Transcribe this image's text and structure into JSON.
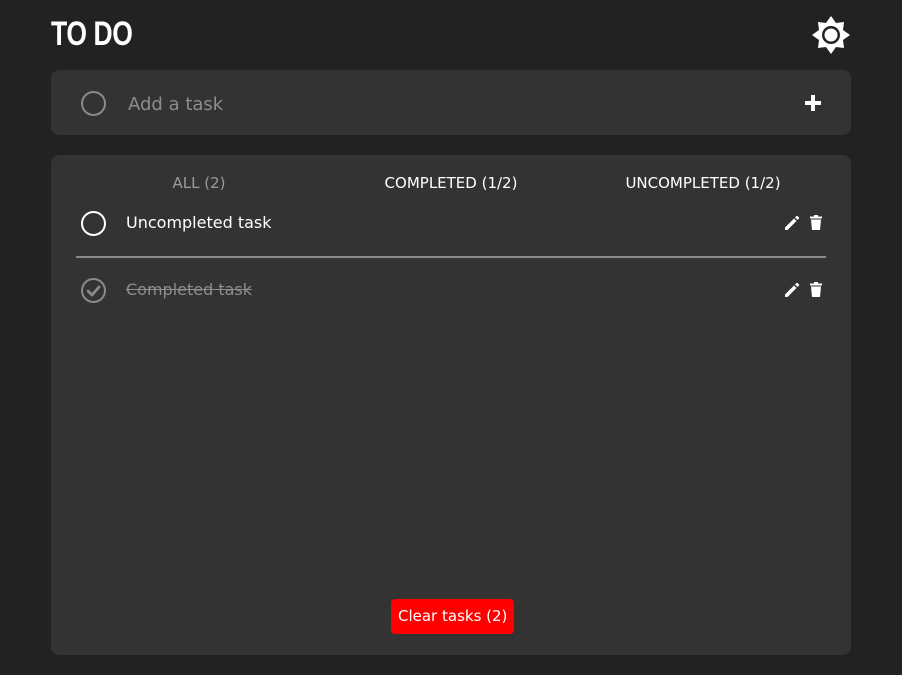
{
  "app": {
    "title": "TO DO"
  },
  "add_task": {
    "placeholder": "Add a task",
    "value": ""
  },
  "tabs": [
    {
      "label": "ALL (2)",
      "active": true
    },
    {
      "label": "COMPLETED (1/2)",
      "active": false
    },
    {
      "label": "UNCOMPLETED (1/2)",
      "active": false
    }
  ],
  "tasks": [
    {
      "label": "Uncompleted task",
      "completed": false
    },
    {
      "label": "Completed task",
      "completed": true
    }
  ],
  "clear_button": {
    "label": "Clear tasks (2)"
  },
  "colors": {
    "background": "#222223",
    "panel": "#333333",
    "muted": "#8d8d8d",
    "danger": "#ff0000"
  },
  "icons": {
    "theme": "sun-icon",
    "add": "plus-icon",
    "edit": "pencil-icon",
    "delete": "trash-icon",
    "check": "check-circle-icon"
  }
}
